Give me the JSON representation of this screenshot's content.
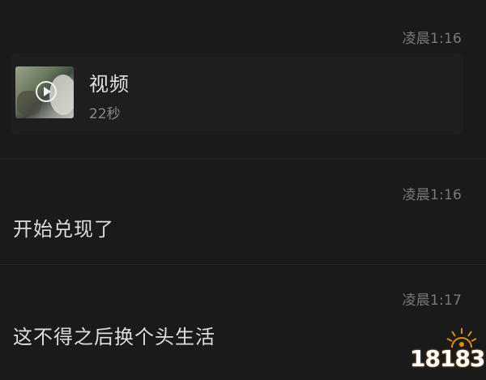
{
  "messages": [
    {
      "time": "凌晨1:16",
      "video": {
        "title": "视频",
        "duration": "22秒",
        "icon": "play-icon"
      }
    },
    {
      "time": "凌晨1:16",
      "text": "开始兑现了"
    },
    {
      "time": "凌晨1:17",
      "text": "这不得之后换个头生活"
    }
  ],
  "watermark": {
    "text": "18183",
    "colors": [
      "#ffffff",
      "#e08a1e"
    ]
  },
  "colors": {
    "background": "#1a1a1a",
    "timestamp": "#7a7a7a",
    "message_text": "#dedede"
  }
}
